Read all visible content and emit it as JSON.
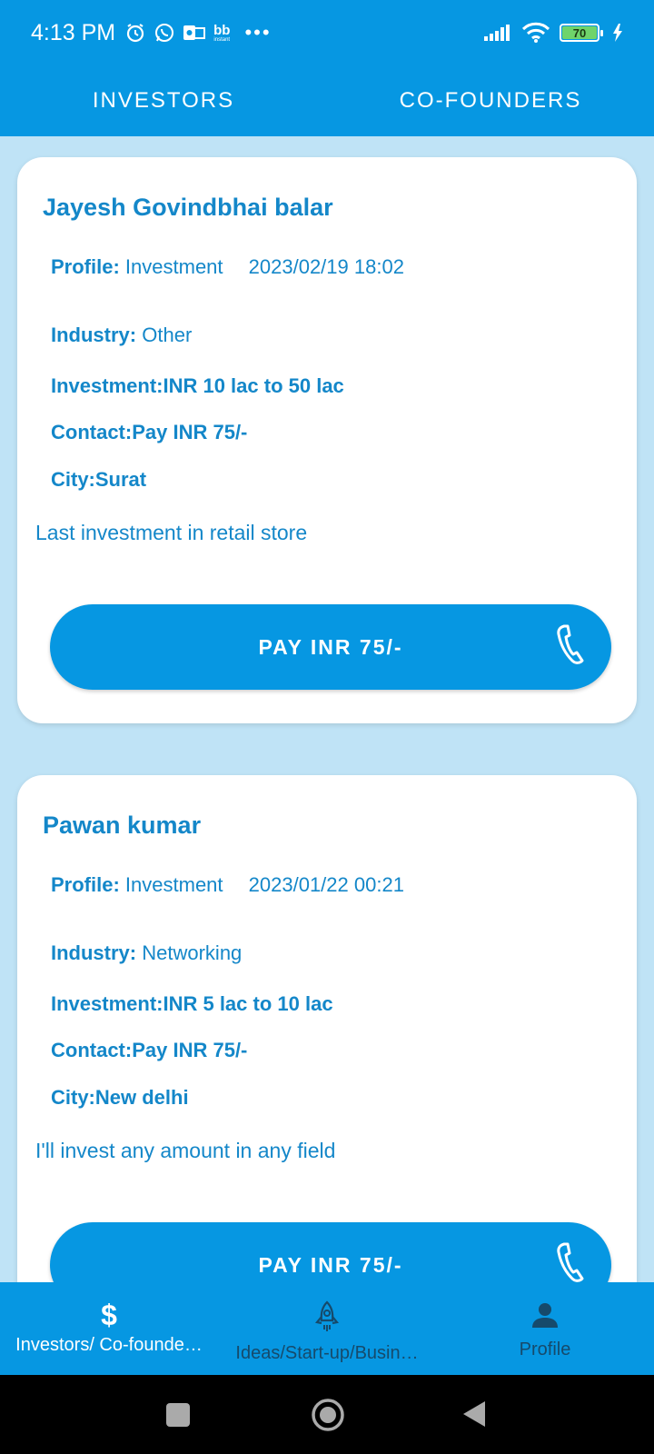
{
  "status_bar": {
    "time": "4:13 PM",
    "notification_icons": [
      "alarm-icon",
      "whatsapp-icon",
      "outlook-icon",
      "bb-instant-icon",
      "more-dots-icon"
    ],
    "battery_level": "70",
    "signal_icon": "signal-icon",
    "wifi_icon": "wifi-icon",
    "charging_icon": "charging-bolt-icon",
    "bb_label": "bb",
    "bb_sublabel": "instant"
  },
  "top_tabs": [
    {
      "label": "INVESTORS"
    },
    {
      "label": "CO-FOUNDERS"
    }
  ],
  "cards": [
    {
      "name": "Jayesh Govindbhai balar",
      "profile_label": "Profile:",
      "profile_value": "Investment",
      "date": "2023/02/19 18:02",
      "industry_label": "Industry:",
      "industry_value": "Other",
      "investment": "Investment:INR 10 lac to 50 lac",
      "contact": "Contact:Pay INR 75/-",
      "city": "City:Surat",
      "description": "Last investment in retail store",
      "button_label": "PAY INR 75/-"
    },
    {
      "name": "Pawan kumar",
      "profile_label": "Profile:",
      "profile_value": "Investment",
      "date": "2023/01/22 00:21",
      "industry_label": "Industry:",
      "industry_value": "Networking",
      "investment": "Investment:INR 5 lac to 10 lac",
      "contact": "Contact:Pay INR 75/-",
      "city": "City:New delhi",
      "description": "I'll invest any amount in any field",
      "button_label": "PAY INR 75/-"
    }
  ],
  "bottom_nav": [
    {
      "label": "Investors/ Co-founde…",
      "icon": "dollar-icon",
      "active": true
    },
    {
      "label": "Ideas/Start-up/Busin…",
      "icon": "rocket-icon",
      "active": false
    },
    {
      "label": "Profile",
      "icon": "person-icon",
      "active": false
    }
  ],
  "colors": {
    "primary": "#0697e2",
    "background": "#bfe3f6",
    "text_blue": "#1487c9",
    "inactive_nav": "#164a6b"
  }
}
